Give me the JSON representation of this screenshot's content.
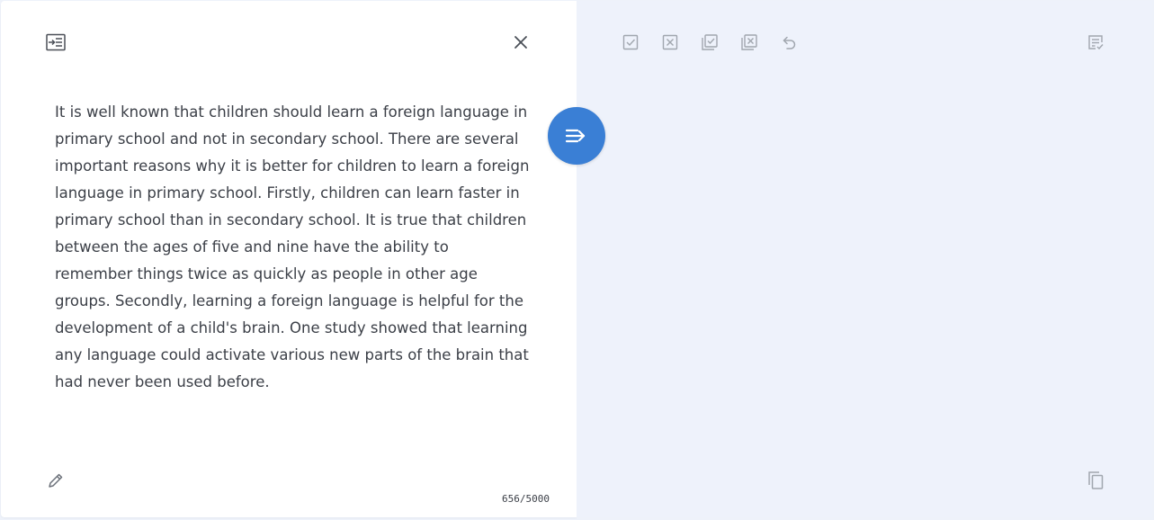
{
  "source": {
    "text": "It is well known that children should learn a foreign language in primary school and not in secondary school. There are several important reasons why it is better for children to learn a foreign language in primary school. Firstly, children can learn faster in primary school than in secondary school. It is true that children between the ages of five and nine have the ability to remember things twice as quickly as people in other age groups. Secondly, learning a foreign language is helpful for the development of a child's brain. One study showed that learning any language could activate various new parts of the brain that had never been used before.",
    "char_count": "656/5000"
  },
  "icons": {
    "insert": "text-insert-icon",
    "close": "close-icon",
    "edit": "pencil-icon",
    "translate": "translate-arrow-icon",
    "accept": "accept-icon",
    "reject": "reject-icon",
    "accept_all": "accept-all-icon",
    "reject_all": "reject-all-icon",
    "undo": "undo-icon",
    "summary": "summary-icon",
    "copy": "copy-icon"
  },
  "colors": {
    "accent": "#3a7fd5",
    "text": "#3b3f47",
    "icon": "#9aa0a8",
    "icon_dark": "#4a4f57",
    "right_bg": "#eef2fb"
  }
}
